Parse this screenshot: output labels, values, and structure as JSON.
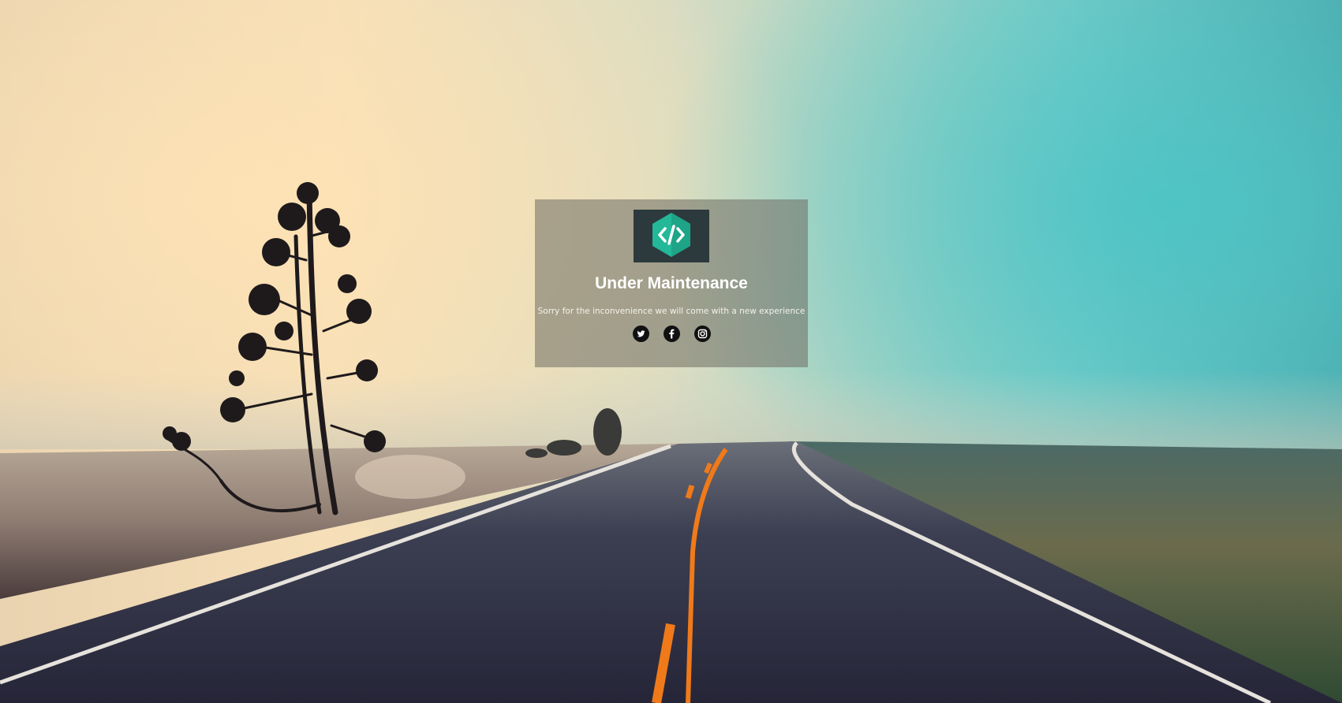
{
  "page": {
    "title": "Under Maintenance",
    "message": "Sorry for the inconvenience we will come with a new experience"
  },
  "logo": {
    "icon": "code-hexagon-icon",
    "accent_color": "#23b898",
    "background_color": "#2c3a3d"
  },
  "socials": [
    {
      "name": "twitter",
      "icon": "twitter-icon"
    },
    {
      "name": "facebook",
      "icon": "facebook-icon"
    },
    {
      "name": "instagram",
      "icon": "instagram-icon"
    }
  ],
  "background": {
    "description_colors": {
      "sky_warm": "#f6dfb8",
      "sky_cool": "#4fb8b8",
      "road": "#2a2c3e",
      "center_line": "#f07a1a"
    }
  }
}
